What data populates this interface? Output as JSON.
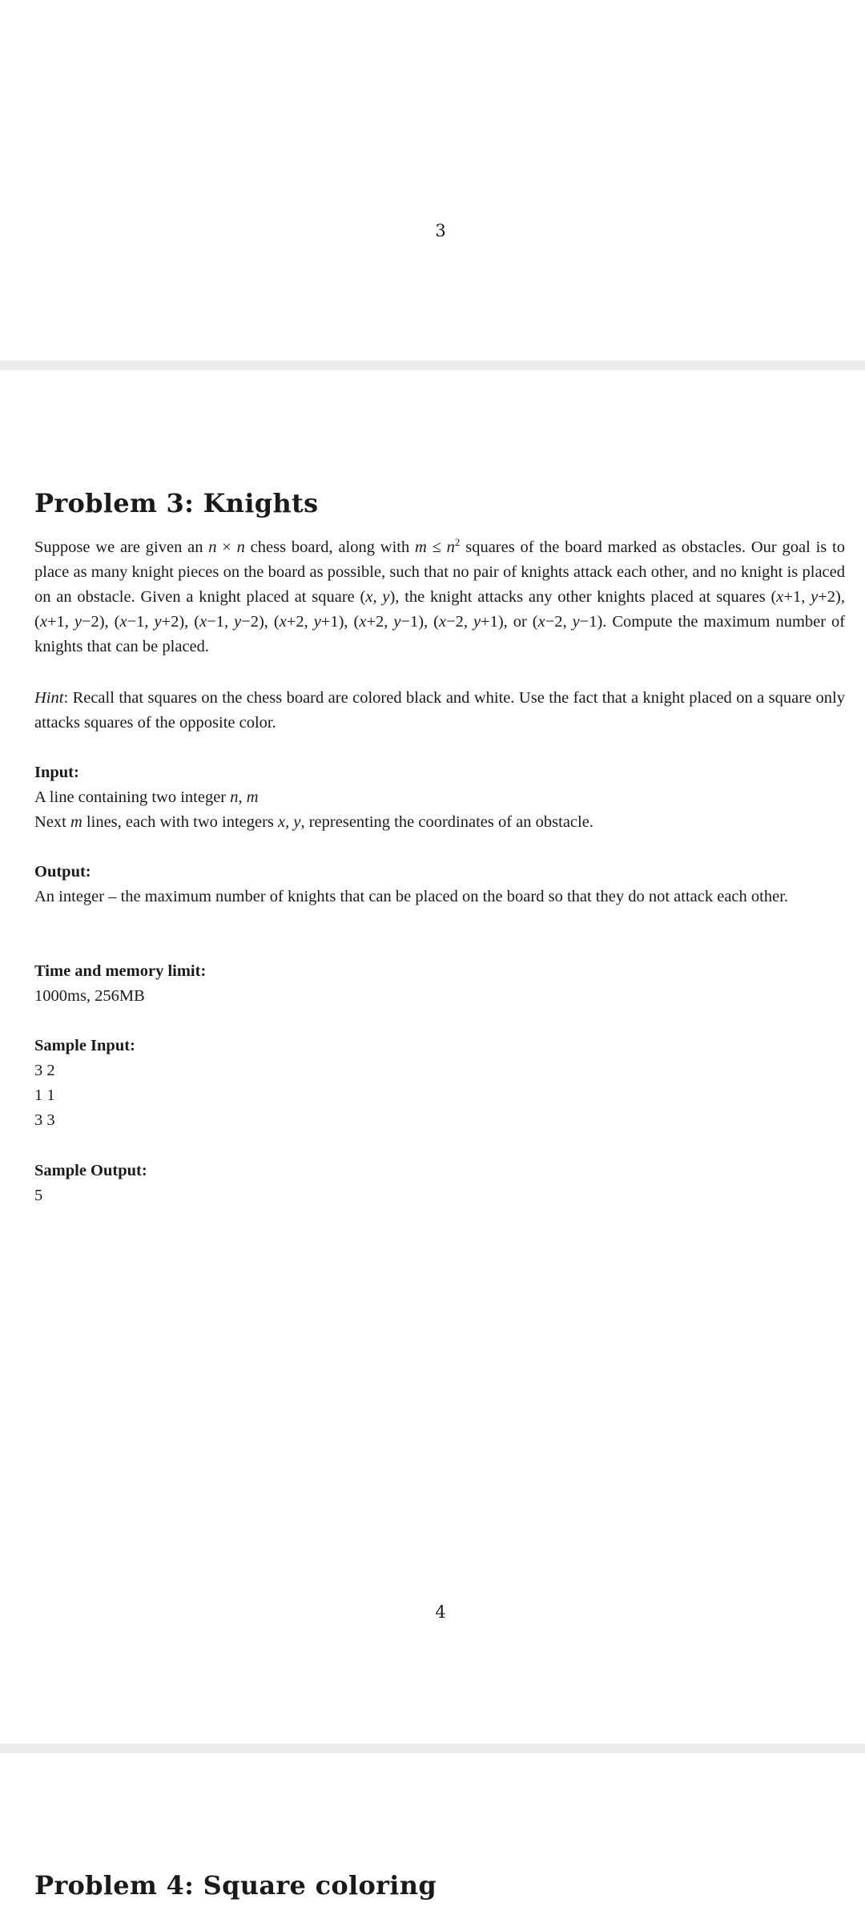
{
  "page_top_number": "3",
  "problem3": {
    "title": "Problem 3: Knights",
    "statement_html": "Suppose we are given an <span class=\"math\">n</span> × <span class=\"math\">n</span> chess board, along with <span class=\"math\">m</span> ≤ <span class=\"math\">n</span><sup>2</sup> squares of the board marked as obstacles. Our goal is to place as many knight pieces on the board as possible, such that no pair of knights attack each other, and no knight is placed on an obstacle. Given a knight placed at square (<span class=\"math\">x, y</span>), the knight attacks any other knights placed at squares (<span class=\"math\">x</span>+1, <span class=\"math\">y</span>+2), (<span class=\"math\">x</span>+1, <span class=\"math\">y</span>−2), (<span class=\"math\">x</span>−1, <span class=\"math\">y</span>+2), (<span class=\"math\">x</span>−1, <span class=\"math\">y</span>−2), (<span class=\"math\">x</span>+2, <span class=\"math\">y</span>+1), (<span class=\"math\">x</span>+2, <span class=\"math\">y</span>−1), (<span class=\"math\">x</span>−2, <span class=\"math\">y</span>+1), or (<span class=\"math\">x</span>−2, <span class=\"math\">y</span>−1). Compute the maximum number of knights that can be placed.",
    "hint_label": "Hint",
    "hint_text": ": Recall that squares on the chess board are colored black and white. Use the fact that a knight placed on a square only attacks squares of the opposite color.",
    "input_heading": "Input:",
    "input_lines_html": [
      "A line containing two integer <span class=\"math\">n, m</span>",
      "Next <span class=\"math\">m</span> lines, each with two integers <span class=\"math\">x, y</span>, representing the coordinates of an obstacle."
    ],
    "output_heading": "Output:",
    "output_text": "An integer – the maximum number of knights that can be placed on the board so that they do not attack each other.",
    "limit_heading": "Time and memory limit:",
    "limit_text": "1000ms, 256MB",
    "sample_input_heading": "Sample Input:",
    "sample_input_lines": [
      "3 2",
      "1 1",
      "3 3"
    ],
    "sample_output_heading": "Sample Output:",
    "sample_output_lines": [
      "5"
    ]
  },
  "page_bottom_number": "4",
  "problem4": {
    "title": "Problem 4: Square coloring"
  },
  "colors": {
    "separator": "#ececec",
    "text": "#1a1a1a",
    "background": "#ffffff"
  }
}
